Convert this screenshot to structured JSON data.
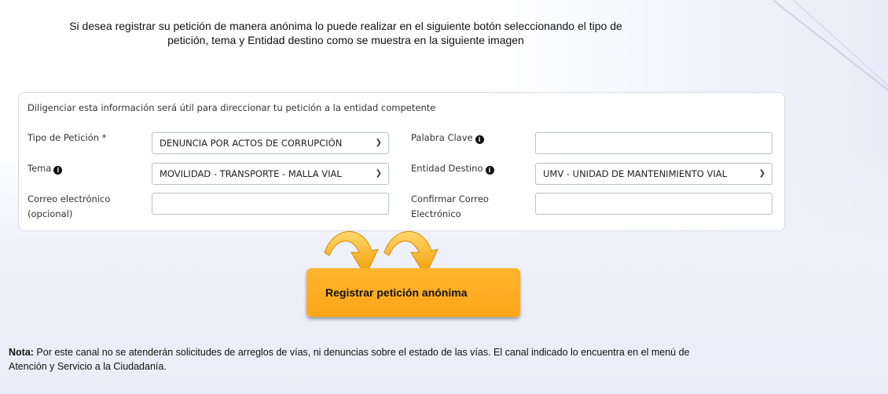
{
  "intro": {
    "line1": "Si  desea registrar su petición de manera anónima lo puede realizar en el siguiente botón  seleccionando el tipo de",
    "line2": "petición, tema y Entidad  destino como se muestra en la siguiente imagen"
  },
  "form": {
    "hint": "Diligenciar esta información será útil para direccionar tu petición a la entidad competente",
    "tipo_label": "Tipo de Petición *",
    "tipo_value": "DENUNCIA POR ACTOS DE CORRUPCIÓN",
    "palabra_label": "Palabra Clave",
    "palabra_value": "",
    "tema_label": "Tema",
    "tema_value": "MOVILIDAD - TRANSPORTE - MALLA VIAL",
    "entidad_label": "Entidad Destino",
    "entidad_value": "UMV - UNIDAD DE MANTENIMIENTO VIAL",
    "correo_label_1": "Correo electrónico",
    "correo_label_2": "(opcional)",
    "correo_value": "",
    "confirmar_label_1": "Confirmar Correo",
    "confirmar_label_2": "Electrónico",
    "confirmar_value": "",
    "info_icon": "info-icon",
    "chevron_icon": "chevron-down-icon"
  },
  "button": {
    "label": "Registrar petición anónima"
  },
  "note": {
    "bold": "Nota:",
    "text": " Por este canal no se atenderán solicitudes de arreglos de vías, ni denuncias sobre el estado de las vías. El canal indicado lo encuentra en el menú de",
    "line2": "Atención y Servicio a la Ciudadanía."
  },
  "colors": {
    "button": "#ffa51a",
    "arrow": "#f5a800",
    "panel_border": "#d8dbe3"
  }
}
